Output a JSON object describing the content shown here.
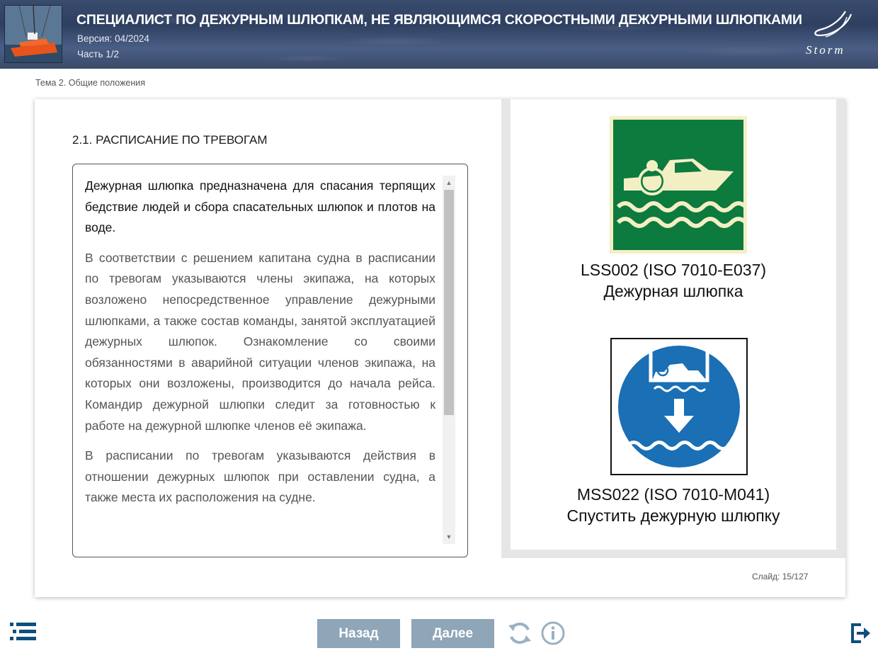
{
  "header": {
    "title": "СПЕЦИАЛИСТ ПО ДЕЖУРНЫМ ШЛЮПКАМ, НЕ ЯВЛЯЮЩИМСЯ СКОРОСТНЫМИ ДЕЖУРНЫМИ ШЛЮПКАМИ",
    "version": "Версия: 04/2024",
    "part": "Часть 1/2",
    "logo_text": "Storm",
    "background_color": "#3a4c6e"
  },
  "breadcrumb": "Тема 2. Общие положения",
  "section": {
    "title": "2.1. РАСПИСАНИЕ ПО ТРЕВОГАМ",
    "paragraphs": [
      "Дежурная шлюпка предназначена для спасания терпящих бедствие людей и сбора спасательных шлюпок и плотов на воде.",
      "В соответствии с решением капитана судна в расписании по тревогам указываются члены экипажа, на которых возложено непосредственное управление дежурными шлюпками, а также состав команды, занятой эксплуатацией дежурных шлюпок. Ознакомление со своими обязанностями в аварийной ситуации членов экипажа, на которых они возложены, производится до начала рейса. Командир дежурной шлюпки следит за готовностью к работе на дежурной шлюпке членов её экипажа.",
      "В расписании по тревогам указываются действия в отношении дежурных шлюпок при оставлении судна, а также места их расположения на судне."
    ]
  },
  "signs": [
    {
      "code": "LSS002 (ISO 7010-E037)",
      "name": "Дежурная шлюпка",
      "icon": "rescue-boat-sign",
      "color": "#0d7a3e"
    },
    {
      "code": "MSS022 (ISO 7010-M041)",
      "name": "Спустить дежурную шлюпку",
      "icon": "launch-rescue-boat-sign",
      "color": "#1a6fb5"
    }
  ],
  "slide_counter": "Слайд: 15/127",
  "footer": {
    "back_label": "Назад",
    "next_label": "Далее",
    "button_color": "#8fa5b8",
    "icon_color": "#0f4f7c"
  }
}
